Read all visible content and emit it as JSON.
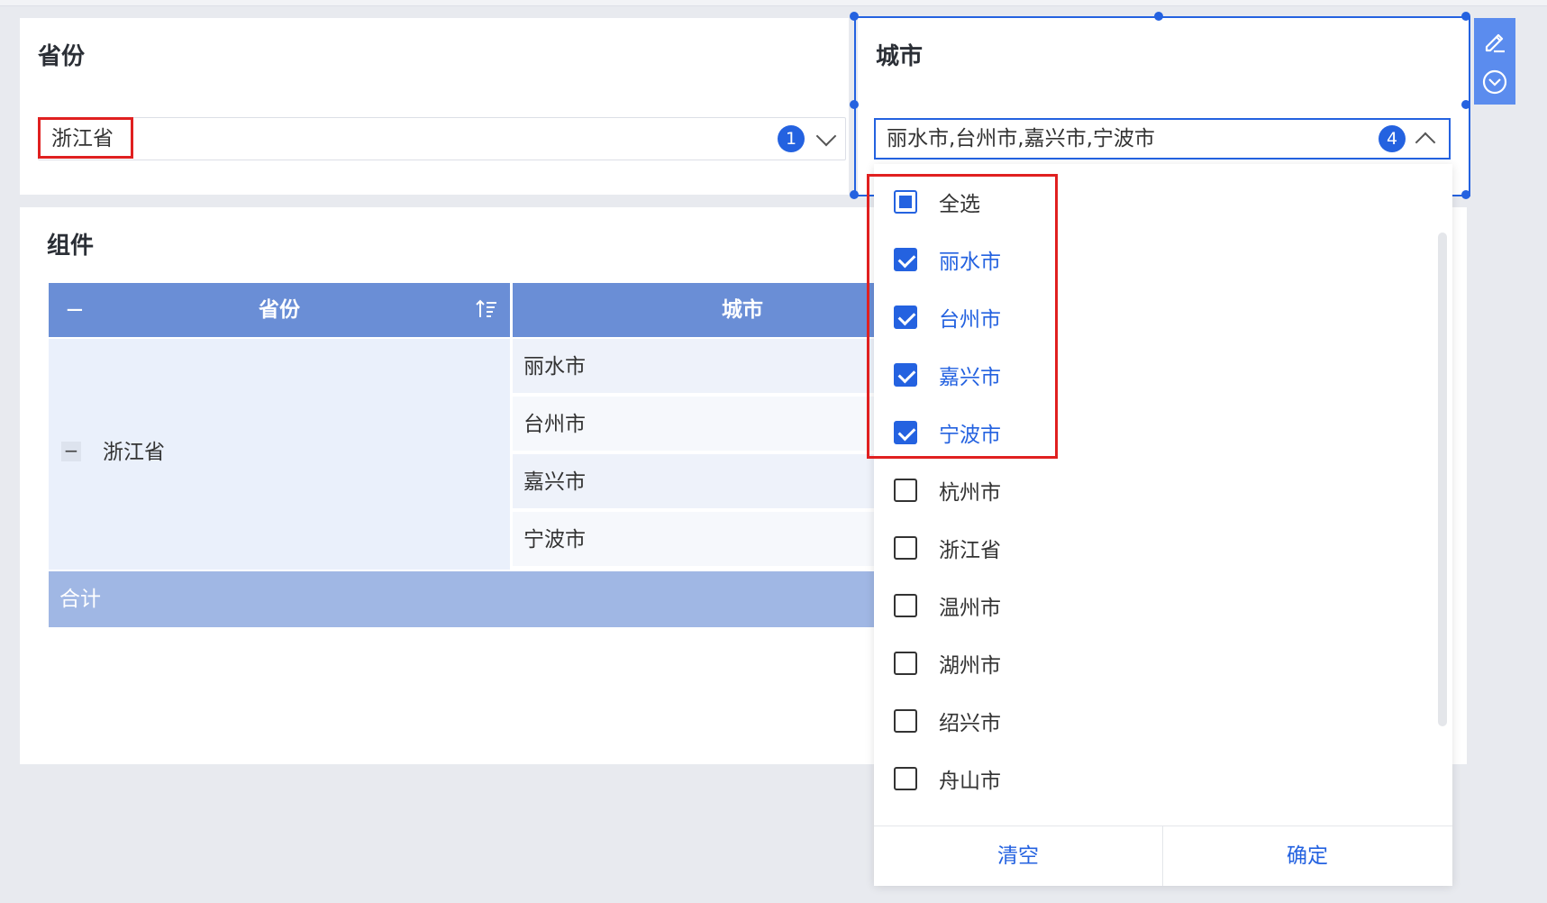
{
  "province_filter": {
    "title": "省份",
    "value": "浙江省",
    "count": "1"
  },
  "city_filter": {
    "title": "城市",
    "value": "丽水市,台州市,嘉兴市,宁波市",
    "count": "4"
  },
  "component": {
    "title": "组件",
    "collapse_symbol": "−",
    "headers": {
      "province": "省份",
      "city": "城市"
    },
    "province": "浙江省",
    "cities": [
      "丽水市",
      "台州市",
      "嘉兴市",
      "宁波市"
    ],
    "total_label": "合计"
  },
  "dropdown": {
    "select_all": {
      "label": "全选",
      "state": "partial"
    },
    "options": [
      {
        "label": "丽水市",
        "checked": true
      },
      {
        "label": "台州市",
        "checked": true
      },
      {
        "label": "嘉兴市",
        "checked": true
      },
      {
        "label": "宁波市",
        "checked": true
      },
      {
        "label": "杭州市",
        "checked": false
      },
      {
        "label": "浙江省",
        "checked": false
      },
      {
        "label": "温州市",
        "checked": false
      },
      {
        "label": "湖州市",
        "checked": false
      },
      {
        "label": "绍兴市",
        "checked": false
      },
      {
        "label": "舟山市",
        "checked": false
      }
    ],
    "clear_label": "清空",
    "confirm_label": "确定"
  },
  "colors": {
    "accent": "#2462e0",
    "header_bg": "#6a8ed6",
    "total_bg": "#a0b7e4",
    "highlight_red": "#e02020"
  },
  "icons": {
    "edit": "edit-icon",
    "more": "chevron-circle-icon",
    "sort": "sort-icon"
  }
}
